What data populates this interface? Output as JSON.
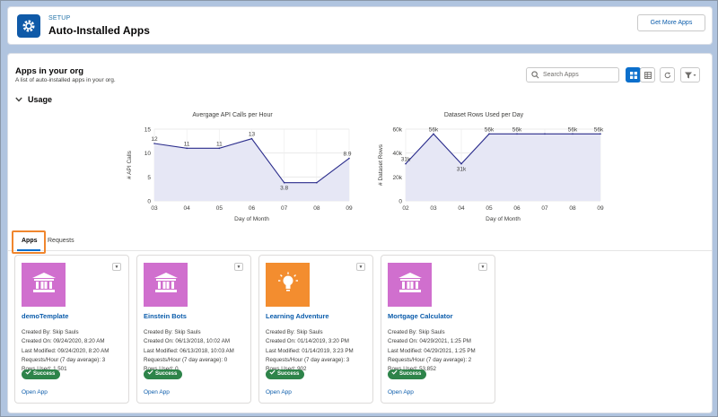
{
  "header": {
    "eyebrow": "SETUP",
    "title": "Auto-Installed Apps",
    "get_more_label": "Get More Apps",
    "icon": "gear-icon"
  },
  "section": {
    "title": "Apps in your org",
    "subtitle": "A list of auto-installed apps in your org.",
    "search_placeholder": "Search Apps",
    "usage_label": "Usage"
  },
  "tabs": [
    {
      "label": "Apps",
      "active": true
    },
    {
      "label": "Requests",
      "active": false
    }
  ],
  "colors": {
    "accent": "#0b6fcc",
    "tile_pink": "#d06fce",
    "tile_orange": "#f38d2f",
    "success": "#2e844a",
    "highlight": "#f0862e"
  },
  "chart_data": [
    {
      "type": "area",
      "title": "Avergage API Calls per Hour",
      "xlabel": "Day of Month",
      "ylabel": "# API Calls",
      "x": [
        "03",
        "04",
        "05",
        "06",
        "07",
        "08",
        "09"
      ],
      "yticks": [
        "0",
        "5",
        "10",
        "15"
      ],
      "ylim": [
        0,
        15
      ],
      "values": [
        12,
        11,
        11,
        13,
        3.8,
        3.8,
        8.9
      ],
      "labels": [
        "12",
        "11",
        "11",
        "13",
        "3.8",
        "",
        "8.9"
      ],
      "grid": true
    },
    {
      "type": "area",
      "title": "Dataset Rows Used per Day",
      "xlabel": "Day of Month",
      "ylabel": "# Dataset Rows",
      "x": [
        "02",
        "03",
        "04",
        "05",
        "06",
        "07",
        "08",
        "09"
      ],
      "yticks": [
        "0",
        "20k",
        "40k",
        "60k"
      ],
      "ylim": [
        0,
        60000
      ],
      "values": [
        31000,
        56000,
        31000,
        56000,
        56000,
        56000,
        56000,
        56000
      ],
      "labels": [
        "31k",
        "56k",
        "31k",
        "56k",
        "56k",
        "",
        "56k",
        "56k"
      ],
      "grid": true
    }
  ],
  "apps": [
    {
      "name": "demoTemplate",
      "icon": "bank-icon",
      "tile": "pink",
      "created_by": "Created By: Skip Sauls",
      "created_on": "Created On: 09/24/2020, 8:20 AM",
      "last_modified": "Last Modified: 09/24/2020, 8:20 AM",
      "requests": "Requests/Hour (7 day average): 3",
      "rows": "Rows Used: 1,501",
      "status": "Success",
      "open_label": "Open App"
    },
    {
      "name": "Einstein Bots",
      "icon": "bank-icon",
      "tile": "pink",
      "created_by": "Created By: Skip Sauls",
      "created_on": "Created On: 06/13/2018, 10:02 AM",
      "last_modified": "Last Modified: 06/13/2018, 10:03 AM",
      "requests": "Requests/Hour (7 day average): 0",
      "rows": "Rows Used: 0",
      "status": "Success",
      "open_label": "Open App"
    },
    {
      "name": "Learning Adventure",
      "icon": "lightbulb-icon",
      "tile": "orange",
      "created_by": "Created By: Skip Sauls",
      "created_on": "Created On: 01/14/2019, 3:20 PM",
      "last_modified": "Last Modified: 01/14/2019, 3:23 PM",
      "requests": "Requests/Hour (7 day average): 3",
      "rows": "Rows Used: 902",
      "status": "Success",
      "open_label": "Open App"
    },
    {
      "name": "Mortgage Calculator",
      "icon": "bank-icon",
      "tile": "pink",
      "created_by": "Created By: Skip Sauls",
      "created_on": "Created On: 04/29/2021, 1:25 PM",
      "last_modified": "Last Modified: 04/29/2021, 1:25 PM",
      "requests": "Requests/Hour (7 day average): 2",
      "rows": "Rows Used: 53,852",
      "status": "Success",
      "open_label": "Open App"
    }
  ]
}
